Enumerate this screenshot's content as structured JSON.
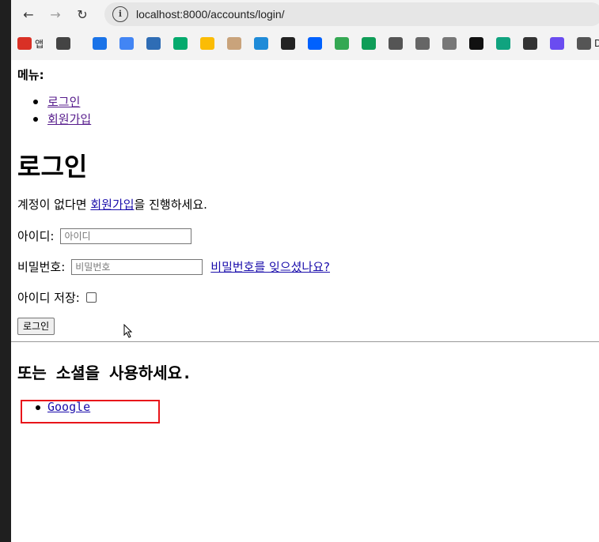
{
  "browser": {
    "back_glyph": "←",
    "forward_glyph": "→",
    "reload_glyph": "↻",
    "url": "localhost:8000/accounts/login/",
    "bookmarks": [
      {
        "icon": "apps-grid-icon",
        "label": "앱",
        "color": "#d93025"
      },
      {
        "icon": "grid-icon",
        "label": "",
        "color": "#444444"
      },
      {
        "icon": "circle-app-icon",
        "label": "",
        "color": "#1a73e8"
      },
      {
        "icon": "calendar-icon",
        "label": "",
        "color": "#4285f4"
      },
      {
        "icon": "mvn-icon",
        "label": "",
        "color": "#2f6db5"
      },
      {
        "icon": "w3-icon",
        "label": "",
        "color": "#04aa6d"
      },
      {
        "icon": "chrome-icon",
        "label": "",
        "color": "#fbbc05"
      },
      {
        "icon": "avatar-icon",
        "label": "",
        "color": "#c9a37b"
      },
      {
        "icon": "tt-icon",
        "label": "",
        "color": "#1f8bd8"
      },
      {
        "icon": "m-icon",
        "label": "",
        "color": "#222222"
      },
      {
        "icon": "dropbox-icon",
        "label": "",
        "color": "#0061fe"
      },
      {
        "icon": "drive-icon",
        "label": "",
        "color": "#34a853"
      },
      {
        "icon": "dot-icon",
        "label": "",
        "color": "#0f9d58"
      },
      {
        "icon": "calendar2-icon",
        "label": "",
        "color": "#555555"
      },
      {
        "icon": "building-icon",
        "label": "",
        "color": "#666666"
      },
      {
        "icon": "cards-icon",
        "label": "",
        "color": "#777777"
      },
      {
        "icon": "openai-icon",
        "label": "",
        "color": "#111111"
      },
      {
        "icon": "chatgpt-icon",
        "label": "",
        "color": "#10a37f"
      },
      {
        "icon": "panel-icon",
        "label": "",
        "color": "#333333"
      },
      {
        "icon": "tools-icon",
        "label": "",
        "color": "#6a4cf0"
      },
      {
        "icon": "folder-icon",
        "label": "De",
        "color": "#555555"
      }
    ]
  },
  "menu": {
    "label": "메뉴:",
    "items": [
      "로그인",
      "회원가입"
    ]
  },
  "login": {
    "title": "로그인",
    "info_prefix": "계정이 없다면 ",
    "signup_link": "회원가입",
    "info_suffix": "을 진행하세요.",
    "id_label": "아이디:",
    "id_placeholder": "아이디",
    "pw_label": "비밀번호:",
    "pw_placeholder": "비밀번호",
    "forgot_link": "비밀번호를 잊으셨나요?",
    "remember_label": "아이디 저장:",
    "submit_label": "로그인"
  },
  "social": {
    "heading": "또는 소셜을 사용하세요.",
    "providers": [
      "Google"
    ]
  },
  "colors": {
    "link": "#1a0dab",
    "visited_link": "#551a8b",
    "highlight": "#e8151a"
  }
}
